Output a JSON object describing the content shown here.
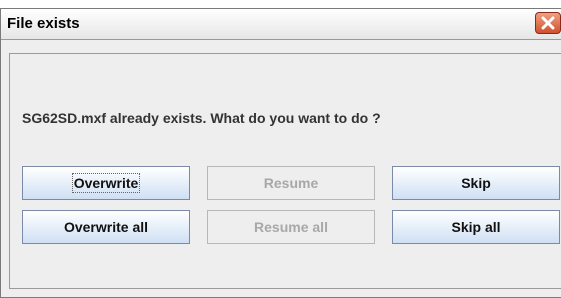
{
  "window": {
    "title": "File exists",
    "close_icon": "close-icon"
  },
  "message": "SG62SD.mxf already exists. What do you want to do ?",
  "buttons": {
    "overwrite": "Overwrite",
    "resume": "Resume",
    "skip": "Skip",
    "overwrite_all": "Overwrite all",
    "resume_all": "Resume all",
    "skip_all": "Skip all"
  },
  "colors": {
    "button_gradient_top": "#ffffff",
    "button_gradient_bottom": "#cfe0f4",
    "disabled_text": "#a8a8a8",
    "close_button": "#d0502e"
  }
}
